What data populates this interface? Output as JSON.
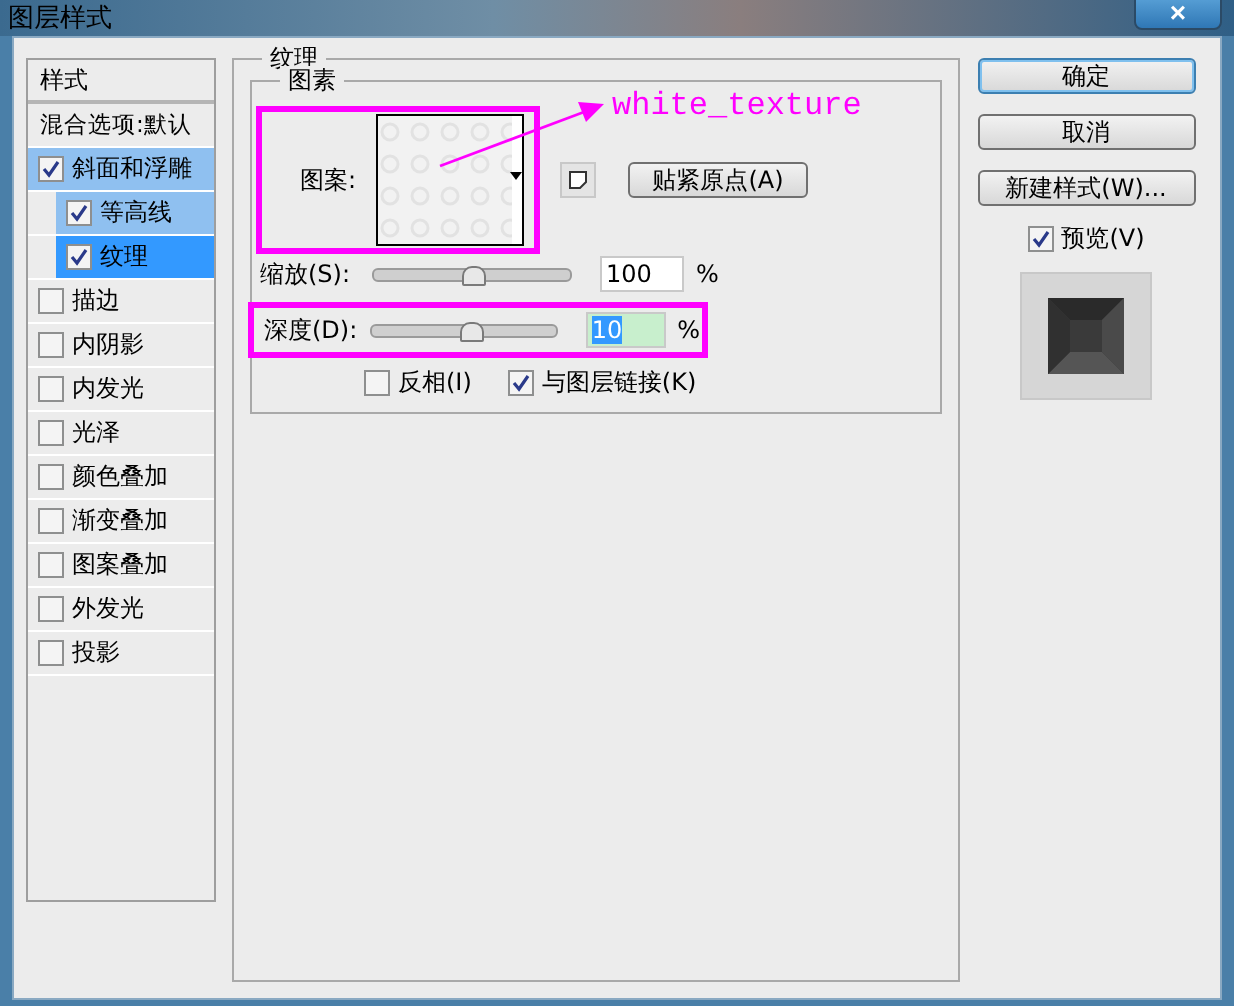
{
  "window": {
    "title": "图层样式",
    "close": "×"
  },
  "sidebar": {
    "header": "样式",
    "blend_options": "混合选项:默认",
    "items": [
      {
        "label": "斜面和浮雕",
        "checked": true,
        "selected": false,
        "highlighted": true,
        "children": [
          {
            "label": "等高线",
            "checked": true,
            "selected": false,
            "highlighted": true
          },
          {
            "label": "纹理",
            "checked": true,
            "selected": true,
            "highlighted": true
          }
        ]
      },
      {
        "label": "描边",
        "checked": false,
        "selected": false,
        "highlighted": false
      },
      {
        "label": "内阴影",
        "checked": false,
        "selected": false,
        "highlighted": false
      },
      {
        "label": "内发光",
        "checked": false,
        "selected": false,
        "highlighted": false
      },
      {
        "label": "光泽",
        "checked": false,
        "selected": false,
        "highlighted": false
      },
      {
        "label": "颜色叠加",
        "checked": false,
        "selected": false,
        "highlighted": false
      },
      {
        "label": "渐变叠加",
        "checked": false,
        "selected": false,
        "highlighted": false
      },
      {
        "label": "图案叠加",
        "checked": false,
        "selected": false,
        "highlighted": false
      },
      {
        "label": "外发光",
        "checked": false,
        "selected": false,
        "highlighted": false
      },
      {
        "label": "投影",
        "checked": false,
        "selected": false,
        "highlighted": false
      }
    ]
  },
  "texture": {
    "title": "纹理",
    "elements_title": "图素",
    "pattern_label": "图案:",
    "pattern_annotated": true,
    "snap_button": "贴紧原点(A)",
    "sliders": [
      {
        "label": "缩放(S):",
        "value": "100",
        "unit": "%",
        "level": 0.5,
        "selected": false,
        "annotated": false
      },
      {
        "label": "深度(D):",
        "value": "10",
        "unit": "%",
        "level": 0.53,
        "selected": true,
        "annotated": true
      }
    ],
    "checkboxes": [
      {
        "label": "反相(I)",
        "checked": false
      },
      {
        "label": "与图层链接(K)",
        "checked": true
      }
    ],
    "annotation": "white_texture"
  },
  "buttons": [
    {
      "label": "确定",
      "default": true
    },
    {
      "label": "取消",
      "default": false
    },
    {
      "label": "新建样式(W)...",
      "default": false
    }
  ],
  "preview": {
    "label": "预览(V)",
    "checked": true
  }
}
